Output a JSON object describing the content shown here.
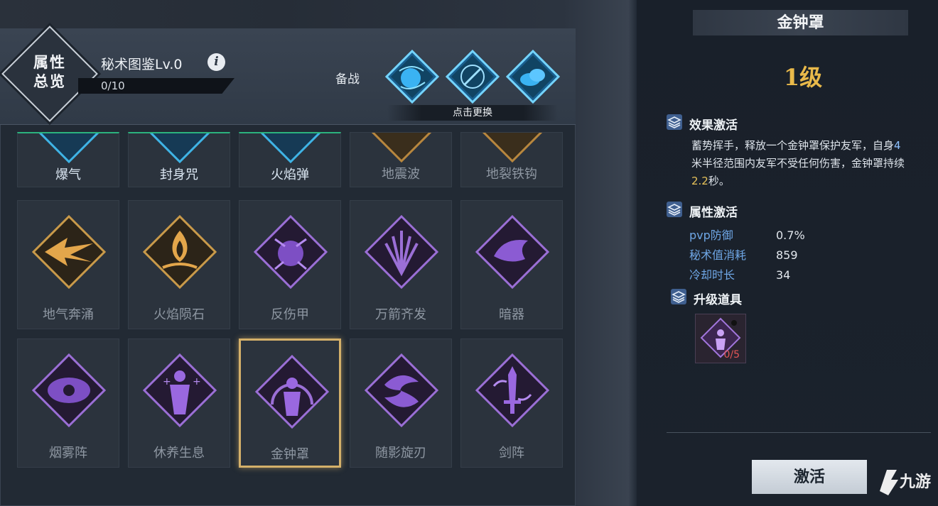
{
  "header": {
    "overview_label": "属性\n总览",
    "codex_title": "秘术图鉴Lv.0",
    "info_icon_text": "i",
    "progress_text": "0/10",
    "progress_fraction": 0,
    "standby_label": "备战",
    "change_hint": "点击更换",
    "slots": [
      {
        "icon": "blue-orb-skill-icon"
      },
      {
        "icon": "blue-seal-skill-icon"
      },
      {
        "icon": "blue-cloud-skill-icon"
      }
    ]
  },
  "grid": {
    "row0": [
      {
        "name": "爆气",
        "tone": "blue"
      },
      {
        "name": "封身咒",
        "tone": "blue"
      },
      {
        "name": "火焰弹",
        "tone": "blue"
      },
      {
        "name": "地震波",
        "tone": "gray"
      },
      {
        "name": "地裂铁钩",
        "tone": "gray"
      }
    ],
    "row1": [
      {
        "name": "地气奔涌",
        "icon": "gold-arrow-icon"
      },
      {
        "name": "火焰陨石",
        "icon": "gold-flame-icon"
      },
      {
        "name": "反伤甲",
        "icon": "purple-orb-icon"
      },
      {
        "name": "万箭齐发",
        "icon": "purple-arrows-icon"
      },
      {
        "name": "暗器",
        "icon": "purple-vortex-icon"
      }
    ],
    "row2": [
      {
        "name": "烟雾阵",
        "icon": "purple-eye-icon"
      },
      {
        "name": "休养生息",
        "icon": "purple-figure-icon"
      },
      {
        "name": "金钟罩",
        "icon": "purple-bell-icon",
        "selected": true
      },
      {
        "name": "随影旋刃",
        "icon": "purple-swirl-icon"
      },
      {
        "name": "剑阵",
        "icon": "purple-sword-icon"
      }
    ]
  },
  "detail": {
    "title": "金钟罩",
    "level": "1级",
    "effect_header": "效果激活",
    "effect_desc": {
      "p1": "蓄势挥手，释放一个金钟罩保护友军，自身",
      "n1": "4",
      "p2": "米半径范围内友军不受任何伤害，金钟罩持续",
      "n2": "2.2",
      "p3": "秒。"
    },
    "attr_header": "属性激活",
    "attributes": [
      {
        "name": "pvp防御",
        "value": "0.7%"
      },
      {
        "name": "秘术值消耗",
        "value": "859"
      },
      {
        "name": "冷却时长",
        "value": "34"
      }
    ],
    "upgrade_header": "升级道具",
    "upgrade_count": "0/5",
    "activate_label": "激活"
  },
  "colors": {
    "accent_gold": "#e9b94a",
    "selected_border": "#d4b06a",
    "tier_line_green": "#2bb37e",
    "attr_blue": "#6fa7e6",
    "count_red": "#e35656"
  }
}
